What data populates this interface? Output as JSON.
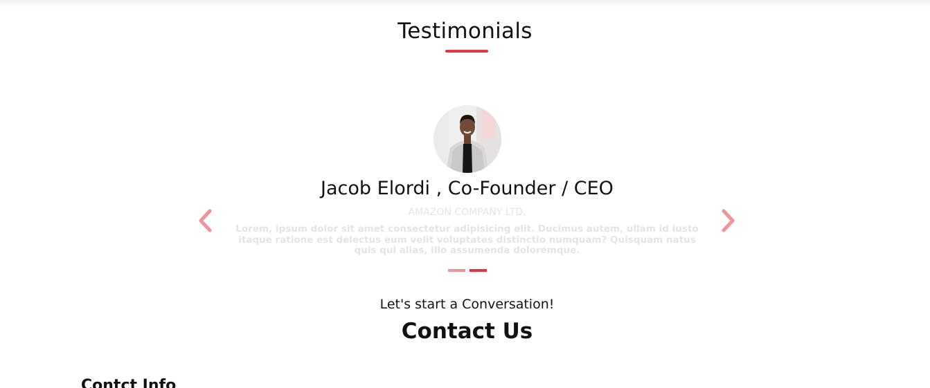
{
  "colors": {
    "accent": "#e3343f",
    "accent_faded": "#f0949a",
    "muted_text": "#e4e4e4"
  },
  "testimonials": {
    "title": "Testimonials",
    "current": {
      "name": "Jacob Elordi , Co-Founder / CEO",
      "company": "AMAZON COMPANY LTD.",
      "quote": "Lorem, ipsum dolor sit amet consectetur adipisicing elit. Ducimus autem, ullam id iusto itaque ratione est delectus eum velit voluptates distinctio numquam? Quisquam natus quis qui alias, illo assumenda doloremque."
    },
    "prev_icon": "chevron-left-icon",
    "next_icon": "chevron-right-icon",
    "slide_count": 2,
    "active_slide": 2
  },
  "contact": {
    "subheading": "Let's start a Conversation!",
    "title": "Contact Us",
    "info_heading": "Contct Info"
  }
}
